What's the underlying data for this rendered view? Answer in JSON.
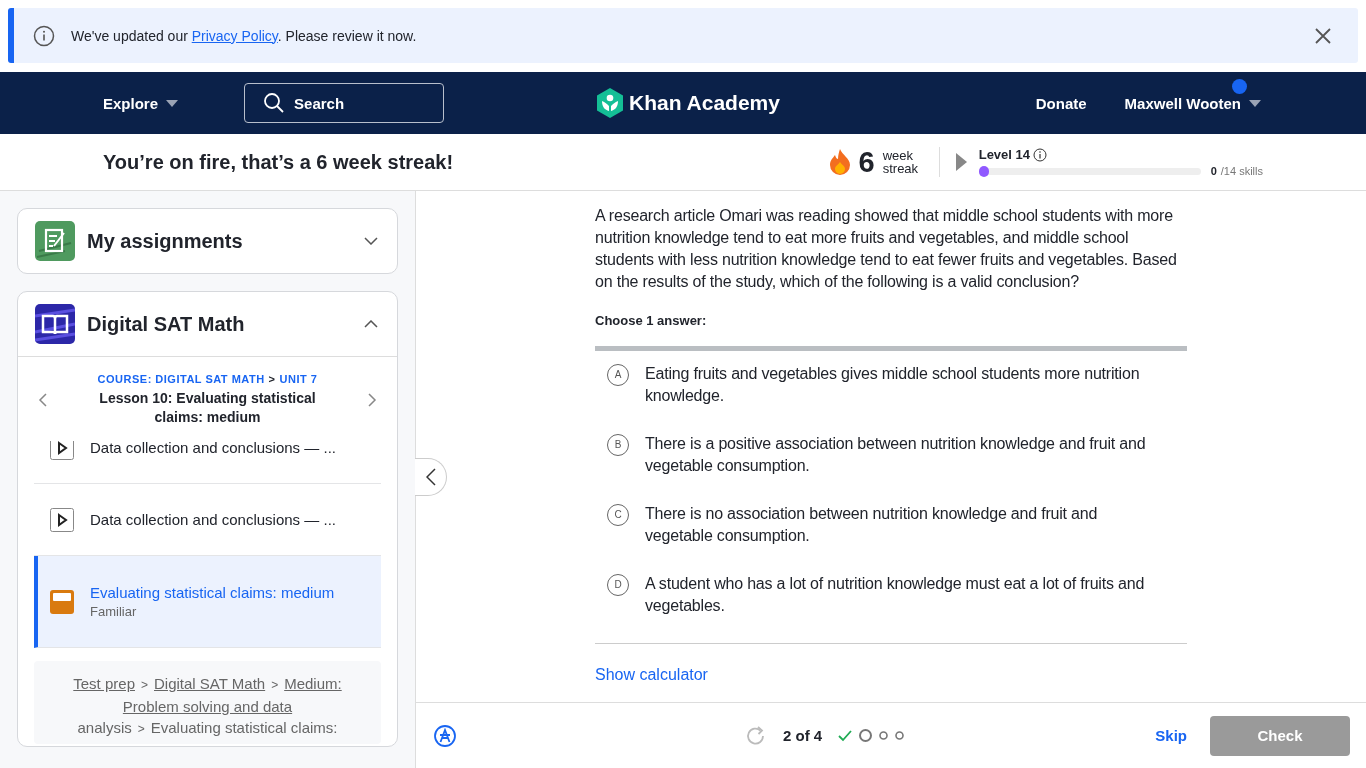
{
  "banner": {
    "text_before": "We've updated our ",
    "link": "Privacy Policy",
    "text_after": ". Please review it now."
  },
  "nav": {
    "explore": "Explore",
    "search": "Search",
    "logo": "Khan Academy",
    "donate": "Donate",
    "user": "Maxwell Wooten",
    "notification": true
  },
  "streak": {
    "message": "You’re on fire, that’s a 6 week streak!",
    "count": "6",
    "unit": "week streak",
    "level_label": "Level 14",
    "level": 0,
    "skills_done": "0",
    "skills_total": "/14 skills"
  },
  "sidebar": {
    "cards": [
      {
        "title": "My assignments",
        "kind": "assignments",
        "expanded": false
      },
      {
        "title": "Digital SAT Math",
        "kind": "course",
        "expanded": true
      }
    ],
    "course_path": {
      "course": "COURSE: DIGITAL SAT MATH",
      "separator": ">",
      "unit": "UNIT 7",
      "lesson": "Lesson 10: Evaluating statistical claims: medium"
    },
    "items": [
      {
        "kind": "video",
        "title": "Data collection and conclusions — ...",
        "selected": false
      },
      {
        "kind": "video",
        "title": "Data collection and conclusions — ...",
        "selected": false
      },
      {
        "kind": "exercise",
        "title": "Evaluating statistical claims: medium",
        "status": "Familiar",
        "selected": true
      }
    ],
    "breadcrumb": {
      "lines": [
        [
          {
            "kind": "link",
            "text": "Test prep"
          },
          {
            "kind": "separator",
            "text": ">"
          },
          {
            "kind": "link",
            "text": "Digital SAT Math"
          },
          {
            "kind": "separator",
            "text": ">"
          },
          {
            "kind": "link",
            "text": "Medium:"
          }
        ],
        [
          {
            "kind": "link",
            "text": "Problem solving and data"
          }
        ],
        [
          {
            "kind": "text",
            "text": "analysis"
          },
          {
            "kind": "separator",
            "text": ">"
          },
          {
            "kind": "text",
            "text": "Evaluating statistical claims:"
          }
        ]
      ]
    }
  },
  "question": {
    "text": "A research article Omari was reading showed that middle school students with more nutrition knowledge tend to eat more fruits and vegetables, and middle school students with less nutrition knowledge tend to eat fewer fruits and vegetables. Based on the results of the study, which of the following is a valid conclusion?",
    "prompt": "Choose 1 answer:",
    "choices": [
      {
        "letter": "A",
        "text": "Eating fruits and vegetables gives middle school students more nutrition knowledge.",
        "selected": false
      },
      {
        "letter": "B",
        "text": "There is a positive association between nutrition knowledge and fruit and vegetable consumption.",
        "selected": false
      },
      {
        "letter": "C",
        "text": "There is no association between nutrition knowledge and fruit and vegetable consumption.",
        "selected": false
      },
      {
        "letter": "D",
        "text": "A student who has a lot of nutrition knowledge must eat a lot of fruits and vegetables.",
        "selected": false
      }
    ],
    "calculator_link": "Show calculator"
  },
  "footer": {
    "progress": "2 of 4",
    "steps": [
      {
        "kind": "done"
      },
      {
        "kind": "current"
      },
      {
        "kind": "todo"
      },
      {
        "kind": "todo"
      }
    ],
    "skip": "Skip",
    "check": "Check",
    "check_disabled": true
  }
}
